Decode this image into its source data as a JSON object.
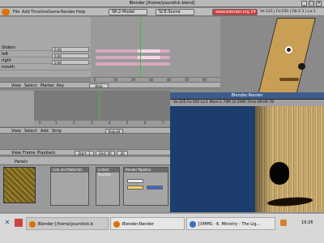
{
  "window": {
    "title": "Blender [/home/yourstick.blend]"
  },
  "header": {
    "menus": [
      "File",
      "Add",
      "Timeline",
      "Game",
      "Render",
      "Help"
    ],
    "scene_field": "SR:2-Model",
    "scene_field2": "SCE:Scene",
    "url_field": "www.blender.org 24",
    "stats": "Ve:125 | Fa:100 | Ob:1-1 | La:1"
  },
  "action_editor": {
    "channels": [
      {
        "name": "Sliders",
        "value": ""
      },
      {
        "name": "left",
        "value": "0.00"
      },
      {
        "name": "right",
        "value": "0.00"
      },
      {
        "name": "mouth",
        "value": "0.00"
      }
    ],
    "ruler_ticks": [
      "0",
      "10",
      "20",
      "30",
      "40",
      "50",
      "60"
    ],
    "header": {
      "view": "View",
      "select": "Select",
      "marker": "Marker",
      "key": "Key",
      "action": "Beta"
    }
  },
  "nla": {
    "ruler_ticks": [
      "0",
      "1",
      "2",
      "3",
      "4",
      "5",
      "6",
      "7"
    ],
    "header": {
      "view": "View",
      "select": "Select",
      "add": "Add",
      "strip": "Strip",
      "bake": "Rebuild"
    }
  },
  "timeline": {
    "view": "View",
    "frame": "Frame",
    "playback": "Playback",
    "start": "Start: 1",
    "end": "End: 40",
    "current": "20"
  },
  "buttons": {
    "header_label": "Panels",
    "panel1_title": "Link and Materials",
    "panel2_title": "Linked Paintlist",
    "panel3_title": "Render Pipeline"
  },
  "render_window": {
    "title": "Blender:Render",
    "stats": "Ve:125 Fa:100 La:1 Mem:1.74M (0.35M) Time:00:00.78"
  },
  "taskbar": {
    "tasks": [
      {
        "label": "Blender [/home/yourstick.b",
        "active": true
      },
      {
        "label": "Blender:Render",
        "active": false
      },
      {
        "label": "[XMMS - 6. Ministry - The Lig...",
        "active": false
      }
    ],
    "clock": "19:26"
  }
}
